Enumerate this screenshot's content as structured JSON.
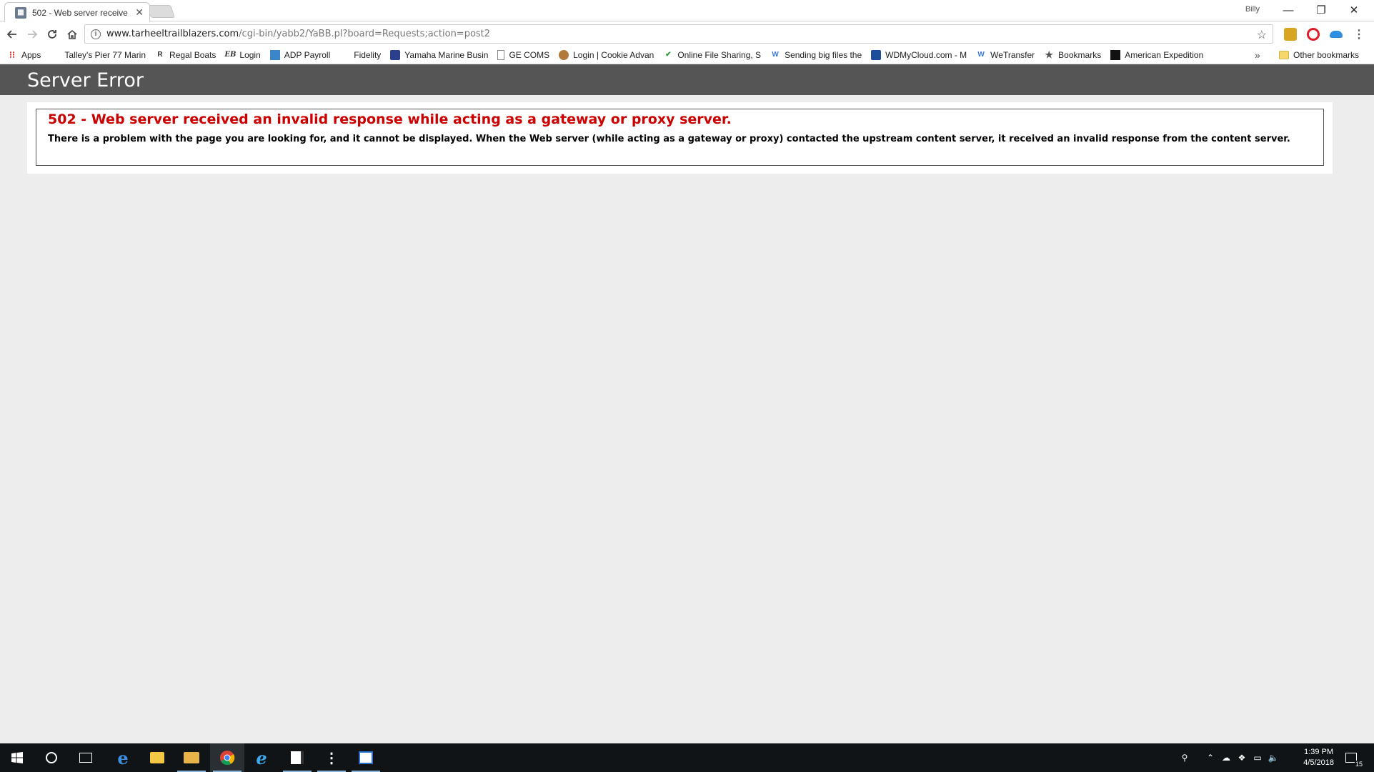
{
  "browser": {
    "tab_title": "502 - Web server receive",
    "profile_name": "Billy",
    "url_domain": "www.tarheeltrailblazers.com",
    "url_path": "/cgi-bin/yabb2/YaBB.pl?board=Requests;action=post2"
  },
  "bookmarks": {
    "items": [
      {
        "label": "Apps",
        "icon": "apps-grid-icon"
      },
      {
        "label": "Talley's Pier 77 Marin",
        "icon": "marina-icon"
      },
      {
        "label": "Regal Boats",
        "icon": "regal-icon"
      },
      {
        "label": "Login",
        "icon": "eb-icon"
      },
      {
        "label": "ADP Payroll",
        "icon": "adp-icon"
      },
      {
        "label": "Fidelity",
        "icon": "fidelity-icon"
      },
      {
        "label": "Yamaha Marine Busin",
        "icon": "yamaha-icon"
      },
      {
        "label": "GE COMS",
        "icon": "page-icon"
      },
      {
        "label": "Login | Cookie Advan",
        "icon": "cookie-icon"
      },
      {
        "label": "Online File Sharing, S",
        "icon": "check-icon"
      },
      {
        "label": "Sending big files the",
        "icon": "wetransfer-icon"
      },
      {
        "label": "WDMyCloud.com - M",
        "icon": "wd-icon"
      },
      {
        "label": "WeTransfer",
        "icon": "wetransfer-icon"
      },
      {
        "label": "Bookmarks",
        "icon": "star-icon"
      },
      {
        "label": "American Expedition",
        "icon": "expedition-icon"
      }
    ],
    "overflow": "»",
    "other": "Other bookmarks"
  },
  "page": {
    "header_title": "Server Error",
    "error_heading": "502 - Web server received an invalid response while acting as a gateway or proxy server.",
    "error_body": "There is a problem with the page you are looking for, and it cannot be displayed. When the Web server (while acting as a gateway or proxy) contacted the upstream content server, it received an invalid response from the content server."
  },
  "taskbar": {
    "time": "1:39 PM",
    "date": "4/5/2018",
    "notification_count": "15"
  },
  "colors": {
    "header_bg": "#555555",
    "error_red": "#cc0000",
    "page_bg": "#ededed"
  }
}
